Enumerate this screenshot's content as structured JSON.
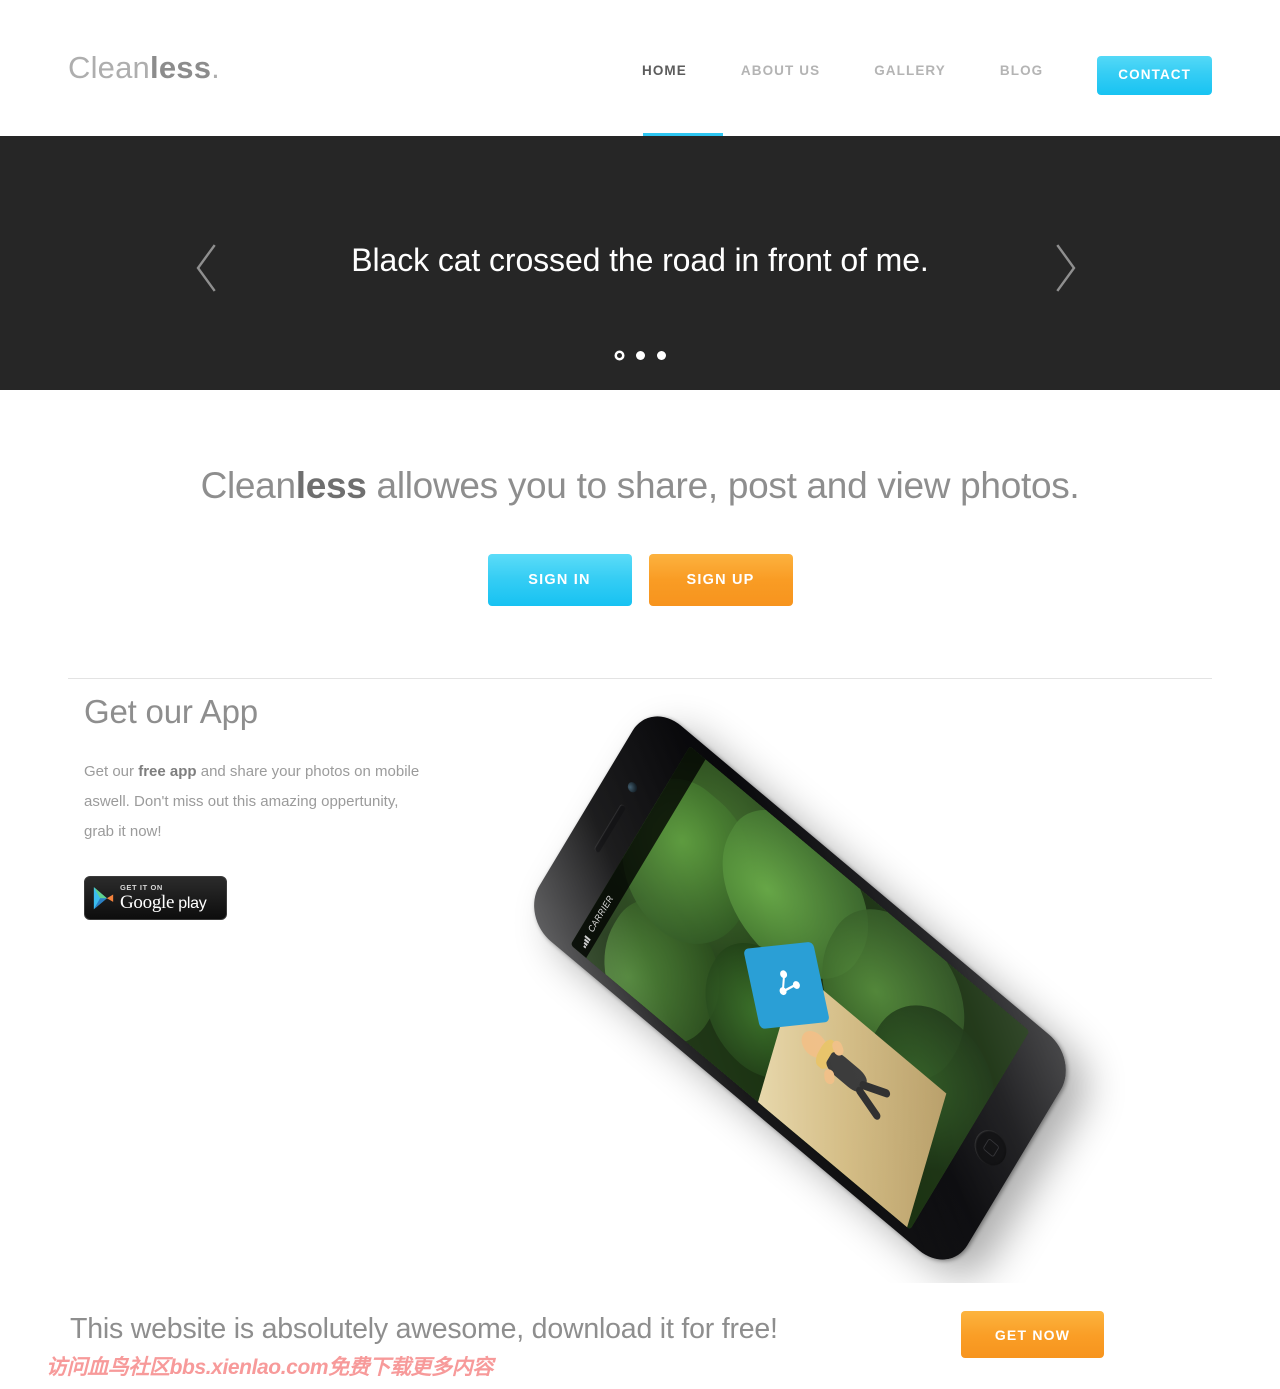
{
  "header": {
    "logo": {
      "light": "Clean",
      "bold": "less",
      "dot": "."
    },
    "nav": [
      {
        "label": "HOME",
        "active": true
      },
      {
        "label": "ABOUT US",
        "active": false
      },
      {
        "label": "GALLERY",
        "active": false
      },
      {
        "label": "BLOG",
        "active": false
      }
    ],
    "contact_label": "CONTACT",
    "accent_color": "#2ec6f2"
  },
  "hero": {
    "slide_title": "Black cat crossed the road in front of me.",
    "prev_icon": "chevron-left-icon",
    "next_icon": "chevron-right-icon",
    "dots_total": 3,
    "dot_current_index": 0,
    "background_color": "#262626"
  },
  "intro": {
    "headline_prefix": "Clean",
    "headline_bold": "less",
    "headline_suffix": " allowes you to share, post and view photos.",
    "sign_in_label": "SIGN IN",
    "sign_up_label": "SIGN UP",
    "sign_in_color": "#35cdf4",
    "sign_up_color": "#f7941e"
  },
  "app": {
    "title": "Get our App",
    "copy_part1": "Get our ",
    "copy_bold": "free app",
    "copy_part2": " and share your photos on mobile aswell. Don't miss out this amazing oppertunity, grab it now!",
    "google_play": {
      "small_text": "GET IT ON",
      "brand": "Google",
      "suffix": " play",
      "icon": "google-play-triangle-icon"
    },
    "phone": {
      "carrier_text": "CARRIER",
      "badge_icon": "share-node-icon",
      "badge_color": "#2a9fd6"
    }
  },
  "cta": {
    "text": "This website is absolutely awesome, download it for free!",
    "button_label": "GET NOW",
    "button_color": "#f7941e"
  },
  "watermark": {
    "text": "访问血鸟社区bbs.xienlao.com免费下载更多内容",
    "color": "#f79a9a"
  }
}
